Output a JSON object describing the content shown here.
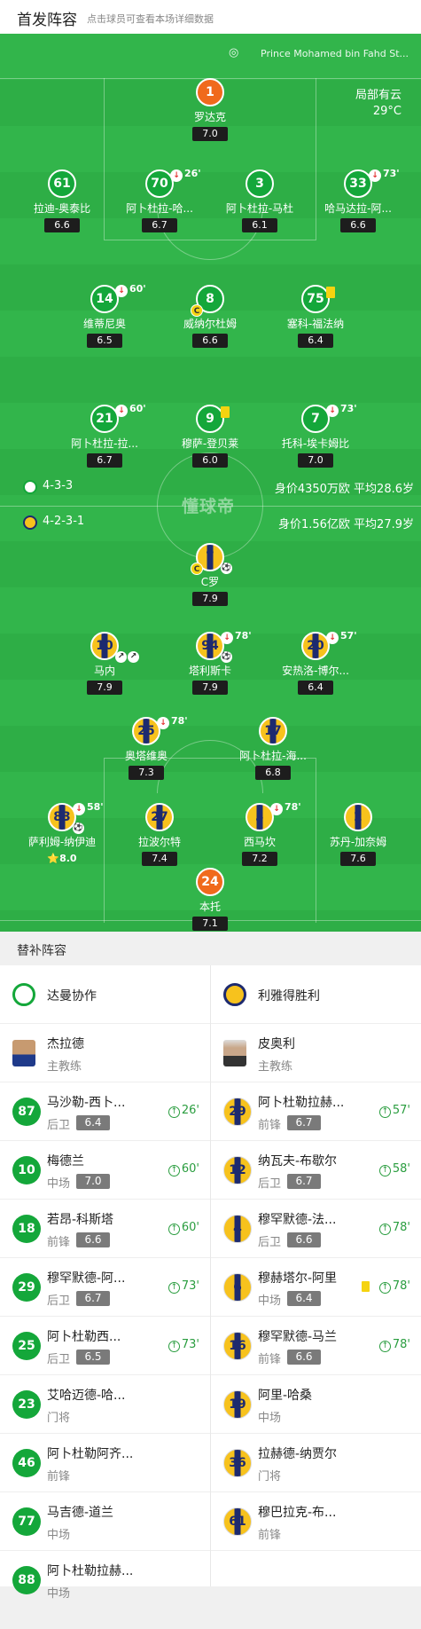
{
  "header": {
    "title": "首发阵容",
    "subtitle": "点击球员可查看本场详细数据"
  },
  "pitch": {
    "venue": "Prince Mohamed bin Fahd St...",
    "weather": "局部有云",
    "temperature": "29°C",
    "watermark": "懂球帝",
    "home_formation": "4-3-3",
    "home_value": "身价4350万欧 平均28.6岁",
    "away_formation": "4-2-3-1",
    "away_value": "身价1.56亿欧  平均27.9岁"
  },
  "home_players": [
    {
      "num": "1",
      "name": "罗达克",
      "rating": "7.0"
    },
    {
      "num": "61",
      "name": "拉迪-奥泰比",
      "rating": "6.6"
    },
    {
      "num": "70",
      "name": "阿卜杜拉-哈...",
      "rating": "6.7",
      "sub": "26'"
    },
    {
      "num": "3",
      "name": "阿卜杜拉-马杜",
      "rating": "6.1"
    },
    {
      "num": "33",
      "name": "哈马达拉-阿...",
      "rating": "6.6",
      "sub": "73'"
    },
    {
      "num": "14",
      "name": "维蒂尼奥",
      "rating": "6.5",
      "sub": "60'"
    },
    {
      "num": "8",
      "name": "威纳尔杜姆",
      "rating": "6.6",
      "captain": "C"
    },
    {
      "num": "75",
      "name": "塞科-福法纳",
      "rating": "6.4"
    },
    {
      "num": "21",
      "name": "阿卜杜拉-拉...",
      "rating": "6.7",
      "sub": "60'"
    },
    {
      "num": "9",
      "name": "穆萨-登贝莱",
      "rating": "6.0"
    },
    {
      "num": "7",
      "name": "托科-埃卡姆比",
      "rating": "7.0",
      "sub": "73'"
    }
  ],
  "away_players": [
    {
      "num": "7",
      "name": "C罗",
      "rating": "7.9",
      "captain": "C"
    },
    {
      "num": "10",
      "name": "马内",
      "rating": "7.9"
    },
    {
      "num": "94",
      "name": "塔利斯卡",
      "rating": "7.9",
      "sub": "78'"
    },
    {
      "num": "20",
      "name": "安热洛-博尔...",
      "rating": "6.4",
      "sub": "57'"
    },
    {
      "num": "25",
      "name": "奥塔维奥",
      "rating": "7.3",
      "sub": "78'"
    },
    {
      "num": "17",
      "name": "阿卜杜拉-海...",
      "rating": "6.8"
    },
    {
      "num": "83",
      "name": "萨利姆-纳伊迪",
      "rating": "8.0",
      "sub": "58'",
      "star": "⭐"
    },
    {
      "num": "27",
      "name": "拉波尔特",
      "rating": "7.4"
    },
    {
      "num": "3",
      "name": "西马坎",
      "rating": "7.2",
      "sub": "78'"
    },
    {
      "num": "2",
      "name": "苏丹-加奈姆",
      "rating": "7.6"
    },
    {
      "num": "24",
      "name": "本托",
      "rating": "7.1"
    }
  ],
  "bench": {
    "title": "替补阵容",
    "home_team": "达曼协作",
    "away_team": "利雅得胜利",
    "home_coach": {
      "name": "杰拉德",
      "role": "主教练"
    },
    "away_coach": {
      "name": "皮奥利",
      "role": "主教练"
    },
    "home_subs": [
      {
        "num": "87",
        "name": "马沙勒-西卜...",
        "pos": "后卫",
        "rating": "6.4",
        "sub": "26'"
      },
      {
        "num": "10",
        "name": "梅德兰",
        "pos": "中场",
        "rating": "7.0",
        "sub": "60'"
      },
      {
        "num": "18",
        "name": "若昂-科斯塔",
        "pos": "前锋",
        "rating": "6.6",
        "sub": "60'"
      },
      {
        "num": "29",
        "name": "穆罕默德-阿...",
        "pos": "后卫",
        "rating": "6.7",
        "sub": "73'"
      },
      {
        "num": "25",
        "name": "阿卜杜勒西...",
        "pos": "后卫",
        "rating": "6.5",
        "sub": "73'"
      },
      {
        "num": "23",
        "name": "艾哈迈德-哈...",
        "pos": "门将"
      },
      {
        "num": "46",
        "name": "阿卜杜勒阿齐...",
        "pos": "前锋"
      },
      {
        "num": "77",
        "name": "马吉德-道兰",
        "pos": "中场"
      },
      {
        "num": "88",
        "name": "阿卜杜勒拉赫...",
        "pos": "中场"
      }
    ],
    "away_subs": [
      {
        "num": "29",
        "name": "阿卜杜勒拉赫...",
        "pos": "前锋",
        "rating": "6.7",
        "sub": "57'"
      },
      {
        "num": "12",
        "name": "纳瓦夫-布歇尔",
        "pos": "后卫",
        "rating": "6.7",
        "sub": "58'"
      },
      {
        "num": "4",
        "name": "穆罕默德-法...",
        "pos": "后卫",
        "rating": "6.6",
        "sub": "78'"
      },
      {
        "num": "6",
        "name": "穆赫塔尔-阿里",
        "pos": "中场",
        "rating": "6.4",
        "sub": "78'",
        "yellow": true
      },
      {
        "num": "16",
        "name": "穆罕默德-马兰",
        "pos": "前锋",
        "rating": "6.6",
        "sub": "78'"
      },
      {
        "num": "19",
        "name": "阿里-哈桑",
        "pos": "中场"
      },
      {
        "num": "36",
        "name": "拉赫德-纳贾尔",
        "pos": "门将"
      },
      {
        "num": "61",
        "name": "穆巴拉克-布...",
        "pos": "前锋"
      }
    ]
  },
  "colors": {
    "pitch": "#2eae46",
    "home": "#14a73a",
    "away_yellow": "#f7c21d",
    "away_navy": "#1d2a6f",
    "gk_home": "#f06a1c"
  }
}
